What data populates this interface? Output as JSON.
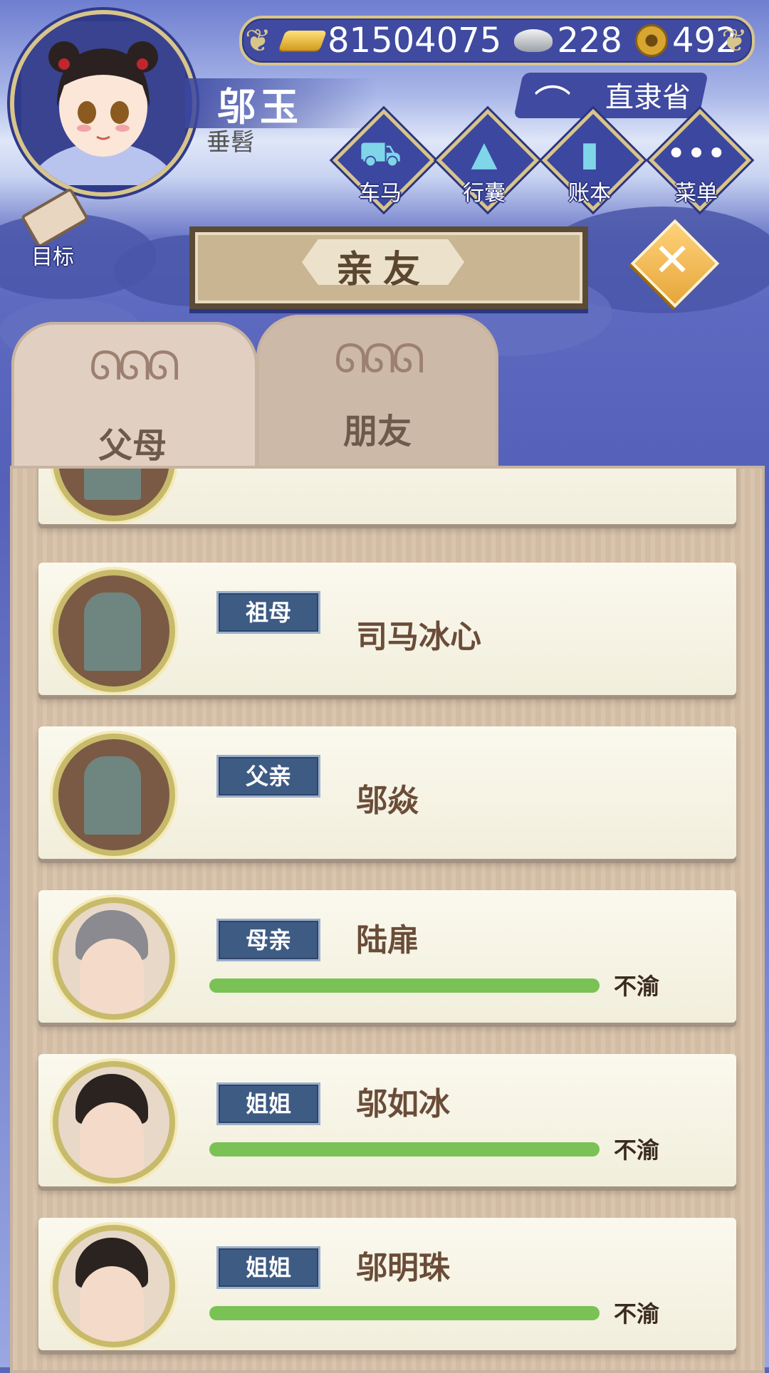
{
  "resources": {
    "gold": "81504075",
    "silver": "228",
    "coins": "492"
  },
  "player": {
    "name": "邬玉",
    "title": "垂髫"
  },
  "location": "直隶省",
  "nav": [
    {
      "label": "车马",
      "icon": "carriage-icon"
    },
    {
      "label": "行囊",
      "icon": "bag-icon"
    },
    {
      "label": "账本",
      "icon": "ledger-icon"
    },
    {
      "label": "菜单",
      "icon": "menu-icon"
    }
  ],
  "goal_label": "目标",
  "page_title": "亲友",
  "tabs": [
    {
      "label": "父母",
      "active": true
    },
    {
      "label": "朋友",
      "active": false
    }
  ],
  "relatives": [
    {
      "relation": "",
      "name": "",
      "deceased": true,
      "mood": "",
      "affection": null
    },
    {
      "relation": "祖母",
      "name": "司马冰心",
      "deceased": true,
      "mood": "",
      "affection": null
    },
    {
      "relation": "父亲",
      "name": "邬焱",
      "deceased": true,
      "mood": "",
      "affection": null
    },
    {
      "relation": "母亲",
      "name": "陆扉",
      "deceased": false,
      "mood": "不渝",
      "affection": 1.0
    },
    {
      "relation": "姐姐",
      "name": "邬如冰",
      "deceased": false,
      "mood": "不渝",
      "affection": 1.0
    },
    {
      "relation": "姐姐",
      "name": "邬明珠",
      "deceased": false,
      "mood": "不渝",
      "affection": 1.0
    }
  ]
}
